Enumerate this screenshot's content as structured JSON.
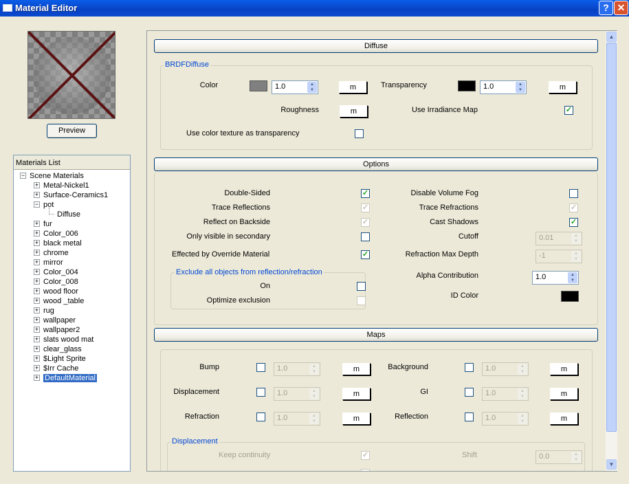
{
  "window": {
    "title": "Material Editor",
    "help_glyph": "?",
    "close_glyph": "✕"
  },
  "preview_button": "Preview",
  "materials_list": {
    "header": "Materials List",
    "root": "Scene Materials",
    "items": [
      "Metal-Nickel1",
      "Surface-Ceramics1",
      "pot",
      "Diffuse",
      "fur",
      "Color_006",
      "black metal",
      "chrome",
      "mirror",
      "Color_004",
      "Color_008",
      "wood floor",
      "wood _table",
      "rug",
      "wallpaper",
      "wallpaper2",
      "slats wood mat",
      "clear_glass",
      "$Light Sprite",
      "$Irr Cache",
      "DefaultMaterial"
    ],
    "selected": "DefaultMaterial"
  },
  "diffuse": {
    "title": "Diffuse",
    "group": "BRDFDiffuse",
    "color_label": "Color",
    "color_value": "1.0",
    "color_swatch": "#808080",
    "transparency_label": "Transparency",
    "transparency_value": "1.0",
    "transparency_swatch": "#000000",
    "roughness_label": "Roughness",
    "irradiance_label": "Use Irradiance Map",
    "texture_label": "Use color texture as transparency",
    "map_button": "m"
  },
  "options": {
    "title": "Options",
    "double_sided": "Double-Sided",
    "trace_reflections": "Trace Reflections",
    "reflect_backside": "Reflect on Backside",
    "only_visible_secondary": "Only visible in secondary",
    "effected_override": "Effected by Override Material",
    "exclude_group": "Exclude all objects from reflection/refraction",
    "on": "On",
    "optimize_exclusion": "Optimize exclusion",
    "disable_volume_fog": "Disable Volume Fog",
    "trace_refractions": "Trace Refractions",
    "cast_shadows": "Cast Shadows",
    "cutoff": "Cutoff",
    "cutoff_value": "0.01",
    "refraction_max_depth": "Refraction Max Depth",
    "refraction_max_depth_value": "-1",
    "alpha_contribution": "Alpha Contribution",
    "alpha_value": "1.0",
    "id_color": "ID Color",
    "id_swatch": "#000000"
  },
  "maps": {
    "title": "Maps",
    "bump": "Bump",
    "displacement": "Displacement",
    "refraction": "Refraction",
    "background": "Background",
    "gi": "GI",
    "reflection": "Reflection",
    "value": "1.0",
    "map_button": "m",
    "disp_group": "Displacement",
    "keep_continuity": "Keep continuity",
    "shift": "Shift",
    "shift_value": "0.0"
  },
  "checkmark": "✓",
  "colors": {
    "title_bar": "#0842c4",
    "selection": "#316ac5",
    "group_label": "#0046d5"
  }
}
